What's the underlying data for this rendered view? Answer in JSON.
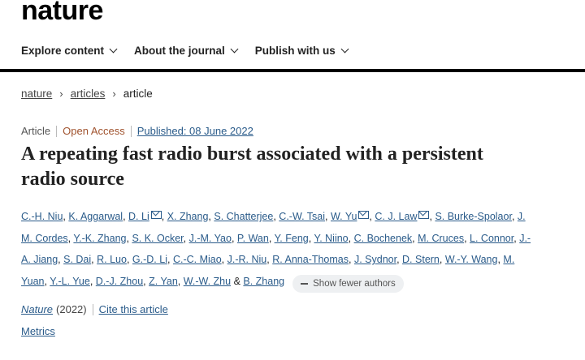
{
  "site": {
    "logo": "nature"
  },
  "nav": {
    "items": [
      "Explore content",
      "About the journal",
      "Publish with us"
    ]
  },
  "breadcrumb": {
    "items": [
      "nature",
      "articles"
    ],
    "current": "article"
  },
  "article": {
    "type": "Article",
    "access": "Open Access",
    "published": "Published: 08 June 2022",
    "title": "A repeating fast radio burst associated with a persistent radio source",
    "authors": [
      {
        "name": "C.-H. Niu",
        "mail": false
      },
      {
        "name": "K. Aggarwal",
        "mail": false
      },
      {
        "name": "D. Li",
        "mail": true
      },
      {
        "name": "X. Zhang",
        "mail": false
      },
      {
        "name": "S. Chatterjee",
        "mail": false
      },
      {
        "name": "C.-W. Tsai",
        "mail": false
      },
      {
        "name": "W. Yu",
        "mail": true
      },
      {
        "name": "C. J. Law",
        "mail": true
      },
      {
        "name": "S. Burke-Spolaor",
        "mail": false
      },
      {
        "name": "J. M. Cordes",
        "mail": false
      },
      {
        "name": "Y.-K. Zhang",
        "mail": false
      },
      {
        "name": "S. K. Ocker",
        "mail": false
      },
      {
        "name": "J.-M. Yao",
        "mail": false
      },
      {
        "name": "P. Wan",
        "mail": false
      },
      {
        "name": "Y. Feng",
        "mail": false
      },
      {
        "name": "Y. Niino",
        "mail": false
      },
      {
        "name": "C. Bochenek",
        "mail": false
      },
      {
        "name": "M. Cruces",
        "mail": false
      },
      {
        "name": "L. Connor",
        "mail": false
      },
      {
        "name": "J.-A. Jiang",
        "mail": false
      },
      {
        "name": "S. Dai",
        "mail": false
      },
      {
        "name": "R. Luo",
        "mail": false
      },
      {
        "name": "G.-D. Li",
        "mail": false
      },
      {
        "name": "C.-C. Miao",
        "mail": false
      },
      {
        "name": "J.-R. Niu",
        "mail": false
      },
      {
        "name": "R. Anna-Thomas",
        "mail": false
      },
      {
        "name": "J. Sydnor",
        "mail": false
      },
      {
        "name": "D. Stern",
        "mail": false
      },
      {
        "name": "W.-Y. Wang",
        "mail": false
      },
      {
        "name": "M. Yuan",
        "mail": false
      },
      {
        "name": "Y.-L. Yue",
        "mail": false
      },
      {
        "name": "D.-J. Zhou",
        "mail": false
      },
      {
        "name": "Z. Yan",
        "mail": false
      },
      {
        "name": "W.-W. Zhu",
        "mail": false
      },
      {
        "name": "B. Zhang",
        "mail": false
      }
    ],
    "and_text": "&",
    "show_fewer_label": "Show fewer authors",
    "journal": "Nature",
    "year": "(2022)",
    "cite_label": "Cite this article",
    "metrics_label": "Metrics"
  },
  "colors": {
    "link": "#2a5b8a",
    "open_access": "#a0522d",
    "rule": "#000000"
  }
}
